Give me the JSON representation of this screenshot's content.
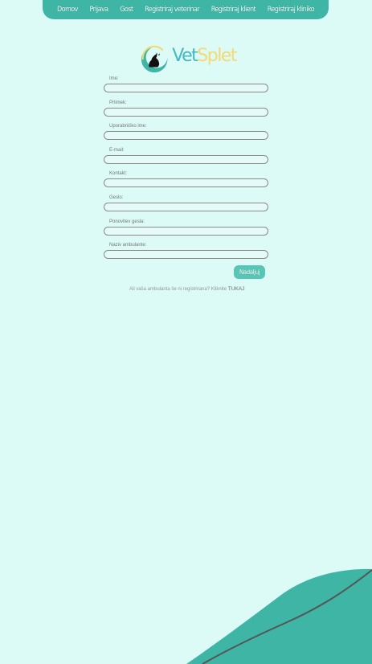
{
  "navbar": {
    "items": [
      {
        "label": "Domov"
      },
      {
        "label": "Prijava"
      },
      {
        "label": "Gost"
      },
      {
        "label": "Registriraj veterinar"
      },
      {
        "label": "Registriraj klient"
      },
      {
        "label": "Registriraj kliniko"
      }
    ]
  },
  "logo": {
    "part1": "Vet",
    "part2": "Splet"
  },
  "form": {
    "fields": [
      {
        "label": "Ime:",
        "value": ""
      },
      {
        "label": "Priimek:",
        "value": ""
      },
      {
        "label": "Uporabniško ime:",
        "value": ""
      },
      {
        "label": "E-mail:",
        "value": ""
      },
      {
        "label": "Kontakt:",
        "value": ""
      },
      {
        "label": "Geslo:",
        "value": ""
      },
      {
        "label": "Ponovitev gesla:",
        "value": ""
      },
      {
        "label": "Naziv ambulante:",
        "value": ""
      }
    ],
    "next_label": "Nadaljuj"
  },
  "footer": {
    "note": "Ali vaša ambulanta še ni registrirana? Kliknite ",
    "link_label": "TUKAJ"
  },
  "colors": {
    "background": "#dcfaf6",
    "accent": "#3fb5a5",
    "logo_vet": "#45b8c0",
    "logo_splet": "#f2db74"
  }
}
